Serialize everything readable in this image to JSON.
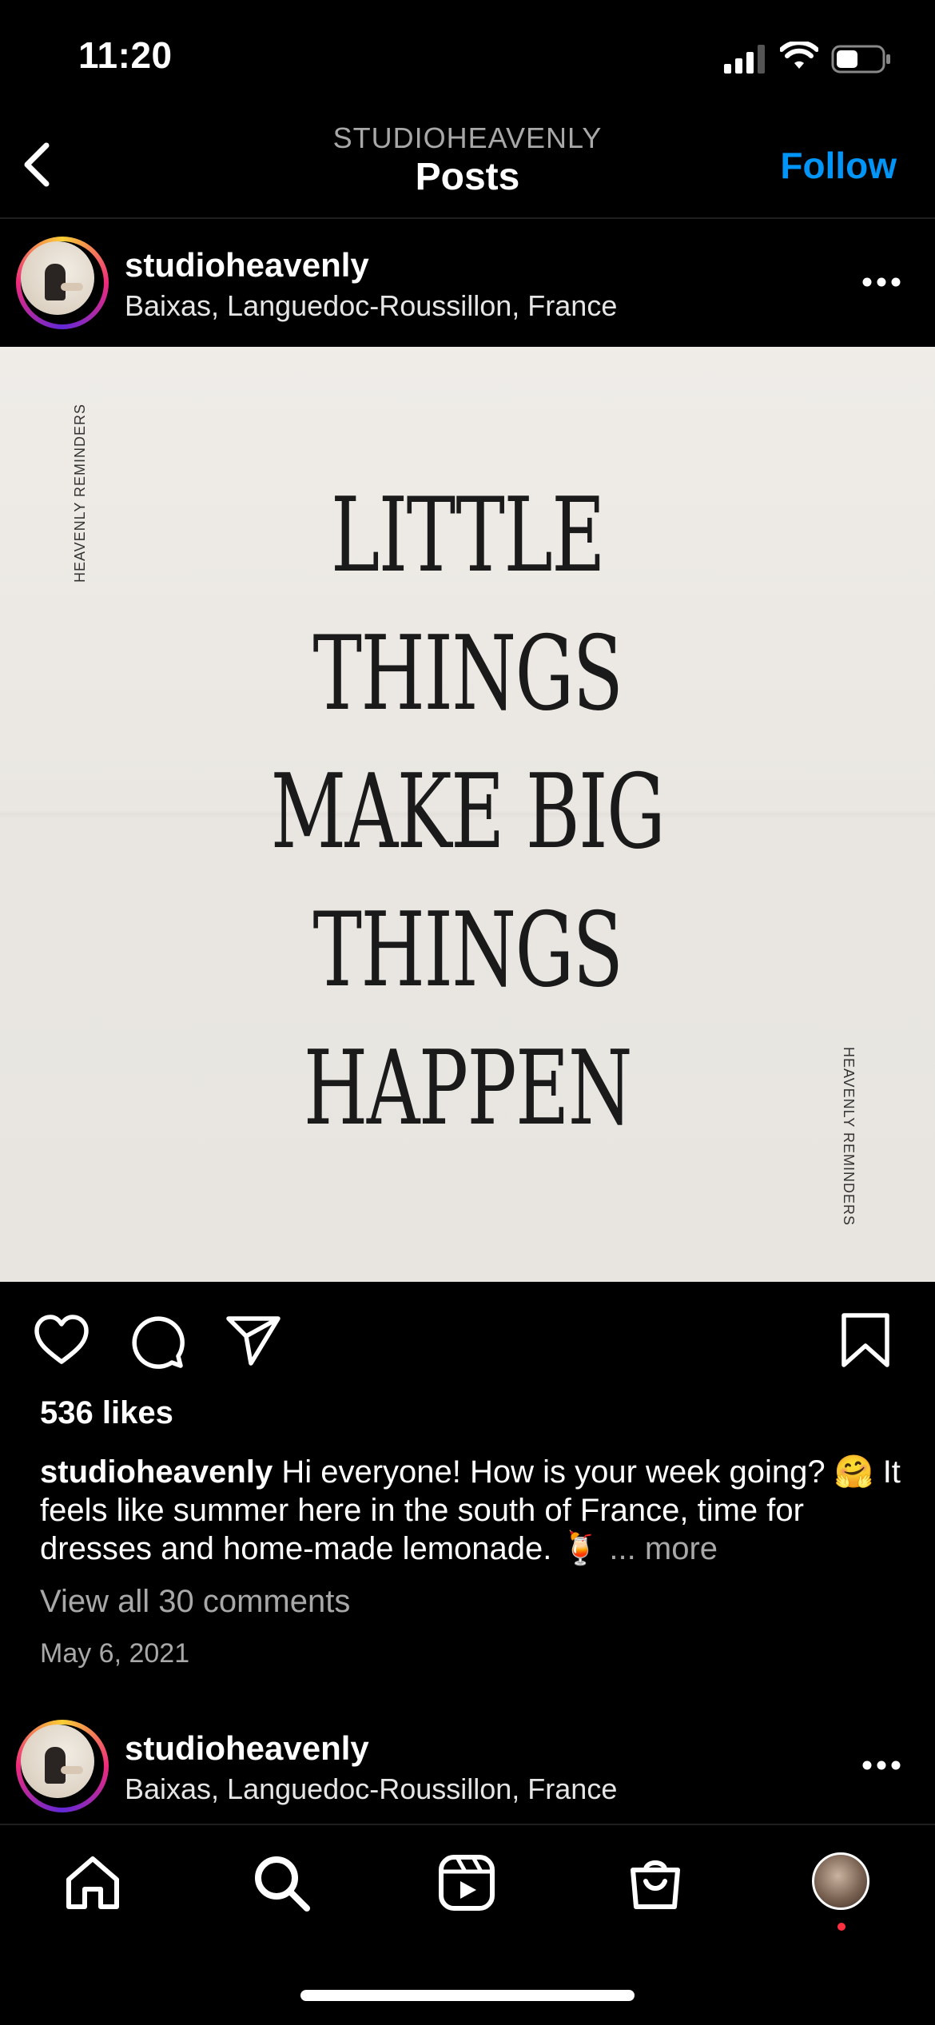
{
  "status": {
    "time": "11:20"
  },
  "header": {
    "subtitle": "STUDIOHEAVENLY",
    "title": "Posts",
    "follow_label": "Follow"
  },
  "post": {
    "username": "studioheavenly",
    "location": "Baixas, Languedoc-Roussillon, France",
    "image_lines": [
      "LITTLE",
      "THINGS",
      "MAKE BIG",
      "THINGS",
      "HAPPEN"
    ],
    "side_label": "HEAVENLY REMINDERS",
    "likes": "536 likes",
    "caption": {
      "username": "studioheavenly",
      "text": "Hi everyone! How is your week going? 🤗 It feels like summer here in the south of France, time for dresses and home-made lemonade. 🍹",
      "more_label": "... more"
    },
    "comments_link": "View all 30 comments",
    "date": "May 6, 2021"
  },
  "next_post": {
    "username": "studioheavenly",
    "location": "Baixas, Languedoc-Roussillon, France"
  },
  "tabbar": {
    "items": [
      {
        "icon": "home-icon"
      },
      {
        "icon": "search-icon"
      },
      {
        "icon": "reels-icon"
      },
      {
        "icon": "shop-icon"
      },
      {
        "icon": "profile-avatar"
      }
    ],
    "notification_color": "#ff3040"
  },
  "colors": {
    "accent": "#0095f6",
    "muted": "#a8a8a8",
    "background": "#000000"
  }
}
